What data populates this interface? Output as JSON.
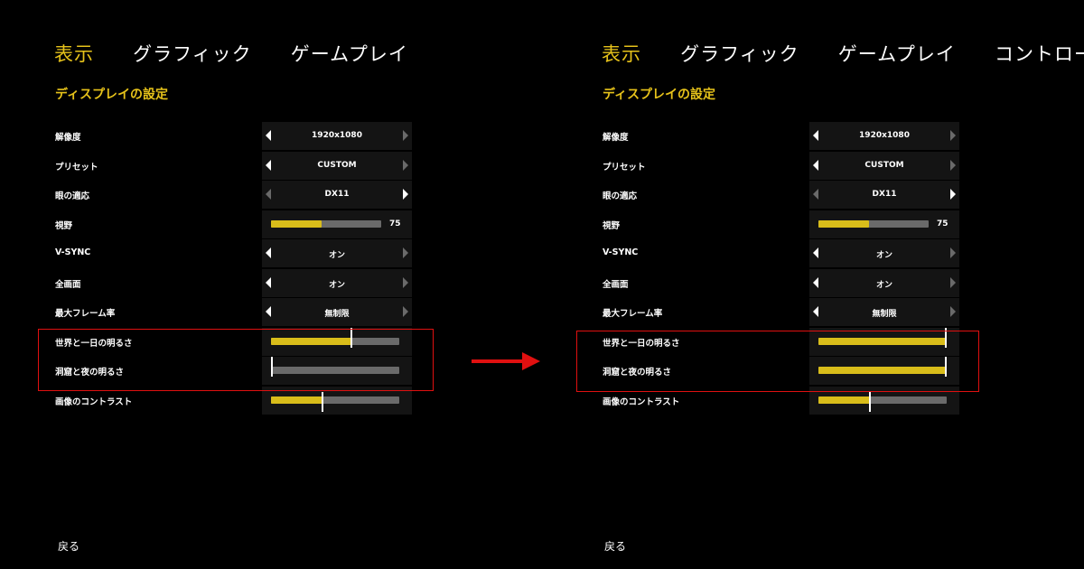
{
  "tabs": [
    "表示",
    "グラフィック",
    "ゲームプレイ",
    "コントロー"
  ],
  "section_title": "ディスプレイの設定",
  "back_label": "戻る",
  "colors": {
    "accent": "#e6c21a",
    "highlight": "#e01010",
    "slider_fill": "#d9bd1a",
    "slider_track": "#6a6a6a"
  },
  "before": {
    "settings": [
      {
        "label": "解像度",
        "type": "select",
        "value": "1920x1080"
      },
      {
        "label": "プリセット",
        "type": "select",
        "value": "CUSTOM"
      },
      {
        "label": "眼の適応",
        "type": "select",
        "value": "DX11"
      },
      {
        "label": "視野",
        "type": "slider",
        "level": 0.46,
        "number": "75"
      },
      {
        "label": "V-SYNC",
        "type": "select",
        "value": "オン"
      },
      {
        "label": "全画面",
        "type": "select",
        "value": "オン"
      },
      {
        "label": "最大フレーム率",
        "type": "select",
        "value": "無制限"
      },
      {
        "label": "世界と一日の明るさ",
        "type": "slider",
        "level": 0.63
      },
      {
        "label": "洞窟と夜の明るさ",
        "type": "slider",
        "level": 0.0
      },
      {
        "label": "画像のコントラスト",
        "type": "slider",
        "level": 0.4
      }
    ]
  },
  "after": {
    "settings": [
      {
        "label": "解像度",
        "type": "select",
        "value": "1920x1080"
      },
      {
        "label": "プリセット",
        "type": "select",
        "value": "CUSTOM"
      },
      {
        "label": "眼の適応",
        "type": "select",
        "value": "DX11"
      },
      {
        "label": "視野",
        "type": "slider",
        "level": 0.46,
        "number": "75"
      },
      {
        "label": "V-SYNC",
        "type": "select",
        "value": "オン"
      },
      {
        "label": "全画面",
        "type": "select",
        "value": "オン"
      },
      {
        "label": "最大フレーム率",
        "type": "select",
        "value": "無制限"
      },
      {
        "label": "世界と一日の明るさ",
        "type": "slider",
        "level": 1.0
      },
      {
        "label": "洞窟と夜の明るさ",
        "type": "slider",
        "level": 1.0
      },
      {
        "label": "画像のコントラスト",
        "type": "slider",
        "level": 0.4
      }
    ]
  }
}
